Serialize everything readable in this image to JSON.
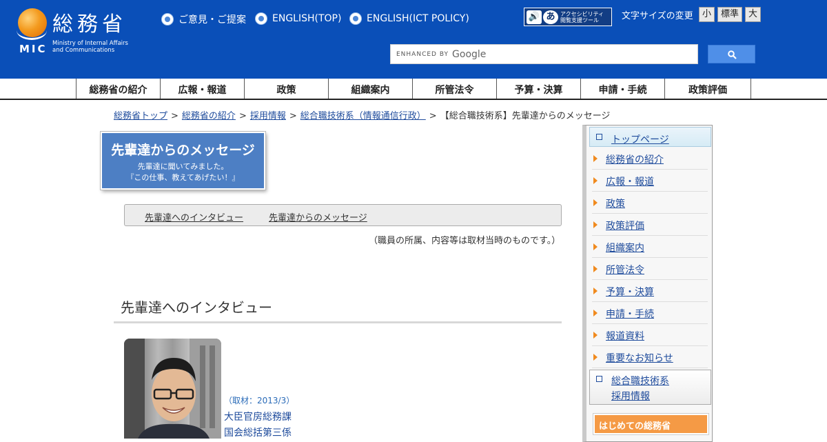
{
  "header": {
    "logo": {
      "kanji": "総務省",
      "abbr": "MIC",
      "english_line1": "Ministry of Internal Affairs",
      "english_line2": "and Communications"
    },
    "links": [
      {
        "label": "ご意見・ご提案"
      },
      {
        "label": "ENGLISH(TOP)"
      },
      {
        "label": "ENGLISH(ICT POLICY)"
      }
    ],
    "accessibility_tool": {
      "glyph": "あ",
      "line1": "アクセシビリティ",
      "line2": "閲覧支援ツール"
    },
    "font_size": {
      "label": "文字サイズの変更",
      "small": "小",
      "standard": "標準",
      "large": "大"
    },
    "search": {
      "enhanced_by": "ENHANCED BY",
      "brand": "Google",
      "button_icon": "search-icon"
    }
  },
  "nav": {
    "items": [
      "総務省の紹介",
      "広報・報道",
      "政策",
      "組織案内",
      "所管法令",
      "予算・決算",
      "申請・手続",
      "政策評価"
    ]
  },
  "breadcrumb": {
    "items": [
      "総務省トップ",
      "総務省の紹介",
      "採用情報",
      "総合職技術系（情報通信行政）"
    ],
    "current": "【総合職技術系】先輩達からのメッセージ",
    "separator": ">"
  },
  "title_box": {
    "title": "先輩達からのメッセージ",
    "sub1": "先輩達に聞いてみました。",
    "sub2": "『この仕事、教えてあげたい！』"
  },
  "tabs": [
    "先輩達へのインタビュー",
    "先輩達からのメッセージ"
  ],
  "note": "（職員の所属、内容等は取材当時のものです。）",
  "section": {
    "title": "先輩達へのインタビュー",
    "interview": {
      "date": "（取材：2013/3）",
      "dept": "大臣官房総務課",
      "section": "国会総括第三係"
    }
  },
  "sidebar": {
    "top_link": "トップページ",
    "items": [
      "総務省の紹介",
      "広報・報道",
      "政策",
      "政策評価",
      "組織案内",
      "所管法令",
      "予算・決算",
      "申請・手続",
      "報道資料",
      "重要なお知らせ"
    ],
    "sub_line1": "総合職技術系",
    "sub_line2": "採用情報",
    "banner": "はじめての総務省"
  },
  "colors": {
    "header_blue": "#0a4fb8",
    "accent_orange": "#f08a1e",
    "link_blue": "#1e4b9c",
    "title_box_blue": "#4d7fc4"
  }
}
